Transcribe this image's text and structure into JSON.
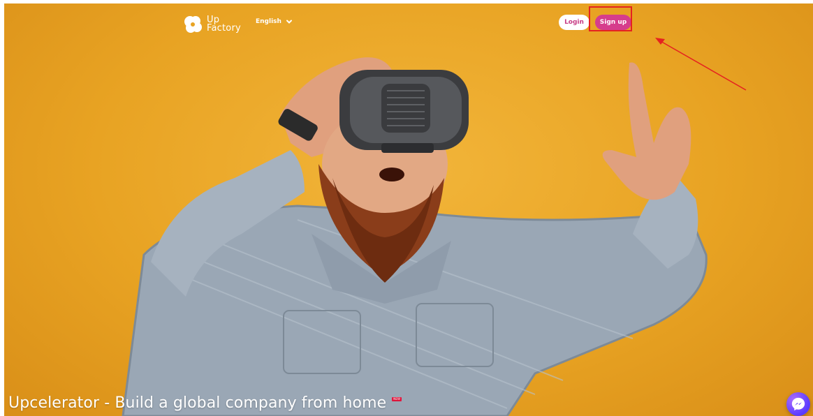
{
  "header": {
    "logo": {
      "line1": "Up",
      "line2": "Factory",
      "icon": "flower-logo-icon"
    },
    "language": {
      "selected": "English",
      "icon": "chevron-down-icon"
    },
    "login_label": "Login",
    "signup_label": "Sign up"
  },
  "hero": {
    "headline": "Upcelerator - Build a global company from home",
    "badge": "NEW"
  },
  "chat": {
    "icon": "messenger-icon"
  },
  "colors": {
    "accent": "#d63d8c",
    "background": "#e8a323",
    "annotation": "#e52220"
  }
}
